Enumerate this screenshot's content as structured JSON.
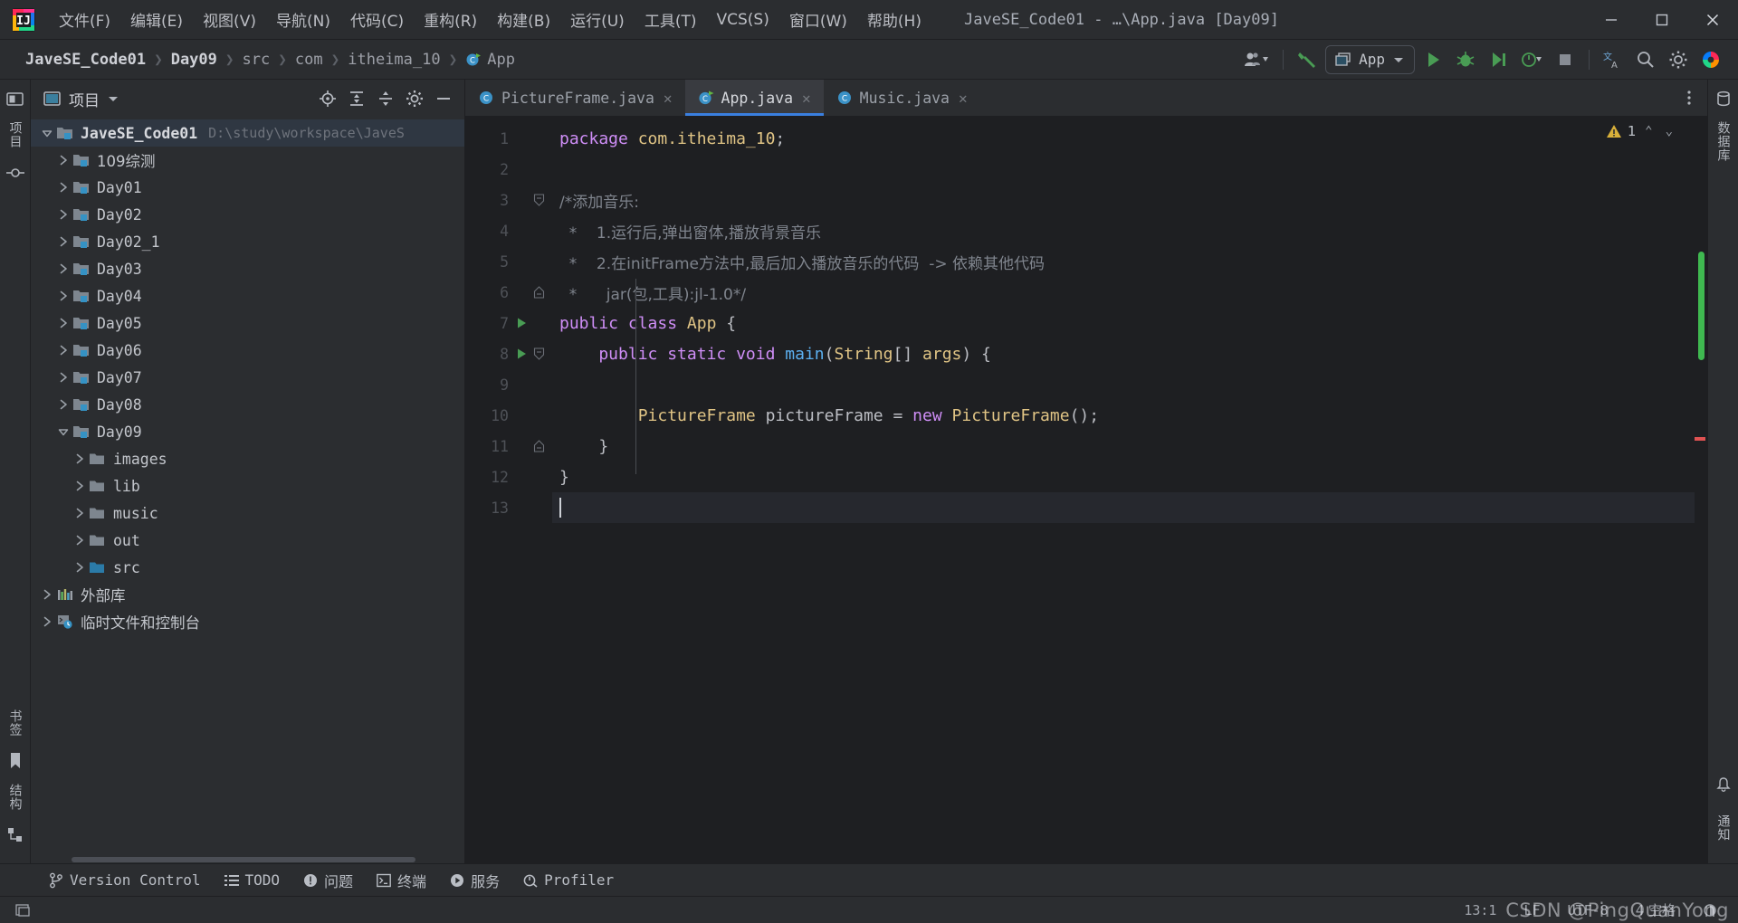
{
  "window": {
    "title": "JaveSE_Code01 - …\\App.java [Day09]",
    "minimize_label": "—",
    "maximize_label": "▢",
    "close_label": "✕"
  },
  "menu": [
    {
      "label": "文件(F)",
      "name": "menu-file"
    },
    {
      "label": "编辑(E)",
      "name": "menu-edit"
    },
    {
      "label": "视图(V)",
      "name": "menu-view"
    },
    {
      "label": "导航(N)",
      "name": "menu-navigate"
    },
    {
      "label": "代码(C)",
      "name": "menu-code"
    },
    {
      "label": "重构(R)",
      "name": "menu-refactor"
    },
    {
      "label": "构建(B)",
      "name": "menu-build"
    },
    {
      "label": "运行(U)",
      "name": "menu-run"
    },
    {
      "label": "工具(T)",
      "name": "menu-tools"
    },
    {
      "label": "VCS(S)",
      "name": "menu-vcs"
    },
    {
      "label": "窗口(W)",
      "name": "menu-window"
    },
    {
      "label": "帮助(H)",
      "name": "menu-help"
    }
  ],
  "breadcrumbs": [
    {
      "label": "JaveSE_Code01"
    },
    {
      "label": "Day09"
    },
    {
      "label": "src"
    },
    {
      "label": "com"
    },
    {
      "label": "itheima_10"
    },
    {
      "label": "App"
    }
  ],
  "breadcrumb_separator": "❯",
  "toolbar": {
    "run_config": "App",
    "run_tooltip": "运行",
    "debug_tooltip": "调试",
    "stop_tooltip": "停止"
  },
  "project_panel": {
    "title": "项目",
    "tree": [
      {
        "indent": 0,
        "twist": "v",
        "label": "JaveSE_Code01",
        "icon": "module-folder",
        "path": "D:\\study\\workspace\\JaveS",
        "bold": true
      },
      {
        "indent": 1,
        "twist": ">",
        "label": "109综测",
        "icon": "module-folder",
        "cjk": true
      },
      {
        "indent": 1,
        "twist": ">",
        "label": "Day01",
        "icon": "module-folder"
      },
      {
        "indent": 1,
        "twist": ">",
        "label": "Day02",
        "icon": "module-folder"
      },
      {
        "indent": 1,
        "twist": ">",
        "label": "Day02_1",
        "icon": "module-folder"
      },
      {
        "indent": 1,
        "twist": ">",
        "label": "Day03",
        "icon": "module-folder"
      },
      {
        "indent": 1,
        "twist": ">",
        "label": "Day04",
        "icon": "module-folder"
      },
      {
        "indent": 1,
        "twist": ">",
        "label": "Day05",
        "icon": "module-folder"
      },
      {
        "indent": 1,
        "twist": ">",
        "label": "Day06",
        "icon": "module-folder"
      },
      {
        "indent": 1,
        "twist": ">",
        "label": "Day07",
        "icon": "module-folder"
      },
      {
        "indent": 1,
        "twist": ">",
        "label": "Day08",
        "icon": "module-folder"
      },
      {
        "indent": 1,
        "twist": "v",
        "label": "Day09",
        "icon": "module-folder"
      },
      {
        "indent": 2,
        "twist": ">",
        "label": "images",
        "icon": "folder"
      },
      {
        "indent": 2,
        "twist": ">",
        "label": "lib",
        "icon": "folder"
      },
      {
        "indent": 2,
        "twist": ">",
        "label": "music",
        "icon": "folder"
      },
      {
        "indent": 2,
        "twist": ">",
        "label": "out",
        "icon": "folder"
      },
      {
        "indent": 2,
        "twist": ">",
        "label": "src",
        "icon": "source-folder"
      },
      {
        "indent": 0,
        "twist": ">",
        "label": "外部库",
        "icon": "external-libraries",
        "cjk": true
      },
      {
        "indent": 0,
        "twist": ">",
        "label": "临时文件和控制台",
        "icon": "scratches",
        "cjk": true
      }
    ]
  },
  "left_rail": [
    {
      "label": "项目",
      "name": "rail-project"
    },
    {
      "label": "提交",
      "name": "rail-commit"
    }
  ],
  "left_rail_bottom": [
    {
      "label": "书签",
      "name": "rail-bookmarks"
    },
    {
      "label": "结构",
      "name": "rail-structure"
    }
  ],
  "right_rail": [
    {
      "label": "数据库",
      "name": "rail-database"
    }
  ],
  "right_rail_bottom": [
    {
      "label": "通知",
      "name": "rail-notifications"
    }
  ],
  "tabs": [
    {
      "label": "PictureFrame.java",
      "active": false,
      "icon": "java-class-icon",
      "close": "✕"
    },
    {
      "label": "App.java",
      "active": true,
      "icon": "java-runnable-class-icon",
      "close": "✕"
    },
    {
      "label": "Music.java",
      "active": false,
      "icon": "java-class-icon",
      "close": "✕"
    }
  ],
  "inspections": {
    "warning_count": "1",
    "up_arrow": "⌃",
    "down_arrow": "⌄"
  },
  "code": {
    "lines": [
      {
        "n": "1",
        "fold": "",
        "run": false,
        "tokens": [
          {
            "t": "package ",
            "c": "kw"
          },
          {
            "t": "com.itheima_10",
            "c": "ty"
          },
          {
            "t": ";",
            "c": "pl"
          }
        ]
      },
      {
        "n": "2",
        "fold": "",
        "run": false,
        "tokens": []
      },
      {
        "n": "3",
        "fold": "open",
        "run": false,
        "tokens": [
          {
            "t": "/*添加音乐:",
            "c": "cmt"
          }
        ]
      },
      {
        "n": "4",
        "fold": "",
        "run": false,
        "tokens": [
          {
            "t": "  *    1.运行后,弹出窗体,播放背景音乐",
            "c": "cmt"
          }
        ]
      },
      {
        "n": "5",
        "fold": "",
        "run": false,
        "tokens": [
          {
            "t": "  *    2.在initFrame方法中,最后加入播放音乐的代码  -> 依赖其他代码",
            "c": "cmt"
          }
        ]
      },
      {
        "n": "6",
        "fold": "close",
        "run": false,
        "tokens": [
          {
            "t": "  *      jar(包,工具):jl-1.0*/",
            "c": "cmt"
          }
        ]
      },
      {
        "n": "7",
        "fold": "",
        "run": true,
        "tokens": [
          {
            "t": "public ",
            "c": "kw"
          },
          {
            "t": "class ",
            "c": "kw"
          },
          {
            "t": "App",
            "c": "ty"
          },
          {
            "t": " {",
            "c": "pl"
          }
        ]
      },
      {
        "n": "8",
        "fold": "open",
        "run": true,
        "tokens": [
          {
            "t": "    public ",
            "c": "kw"
          },
          {
            "t": "static ",
            "c": "kw"
          },
          {
            "t": "void ",
            "c": "kw"
          },
          {
            "t": "main",
            "c": "fn"
          },
          {
            "t": "(",
            "c": "pl"
          },
          {
            "t": "String",
            "c": "ty"
          },
          {
            "t": "[] ",
            "c": "pl"
          },
          {
            "t": "args",
            "c": "ty"
          },
          {
            "t": ") {",
            "c": "pl"
          }
        ]
      },
      {
        "n": "9",
        "fold": "",
        "run": false,
        "tokens": []
      },
      {
        "n": "10",
        "fold": "",
        "run": false,
        "tokens": [
          {
            "t": "        PictureFrame",
            "c": "ty"
          },
          {
            "t": " pictureFrame ",
            "c": "pl"
          },
          {
            "t": "= ",
            "c": "pl"
          },
          {
            "t": "new ",
            "c": "kw"
          },
          {
            "t": "PictureFrame",
            "c": "ty"
          },
          {
            "t": "();",
            "c": "pl"
          }
        ]
      },
      {
        "n": "11",
        "fold": "close",
        "run": false,
        "tokens": [
          {
            "t": "    }",
            "c": "pl"
          }
        ]
      },
      {
        "n": "12",
        "fold": "",
        "run": false,
        "tokens": [
          {
            "t": "}",
            "c": "pl"
          }
        ]
      },
      {
        "n": "13",
        "fold": "",
        "run": false,
        "caret": true,
        "tokens": []
      }
    ]
  },
  "bottom_toolwindows": [
    {
      "label": "Version Control",
      "icon": "branch-icon",
      "name": "toolwindow-version-control"
    },
    {
      "label": "TODO",
      "icon": "todo-icon",
      "name": "toolwindow-todo"
    },
    {
      "label": "问题",
      "icon": "problems-icon",
      "name": "toolwindow-problems",
      "cjk": true
    },
    {
      "label": "终端",
      "icon": "terminal-icon",
      "name": "toolwindow-terminal",
      "cjk": true
    },
    {
      "label": "服务",
      "icon": "services-icon",
      "name": "toolwindow-services",
      "cjk": true
    },
    {
      "label": "Profiler",
      "icon": "profiler-icon",
      "name": "toolwindow-profiler"
    }
  ],
  "status_bar": {
    "caret_position": "13:1",
    "line_separator": "LF",
    "encoding": "UTF-8",
    "indent": "4 空格",
    "watermark": "CSDN @PingQuanYong"
  },
  "colors": {
    "accent_blue": "#3a7fe0",
    "run_green": "#499c54",
    "folder_blue": "#3592c4",
    "warning_yellow": "#d9b03a",
    "error_red": "#e05252",
    "bg_panel": "#2b2d30",
    "bg_editor": "#1e1f22"
  }
}
